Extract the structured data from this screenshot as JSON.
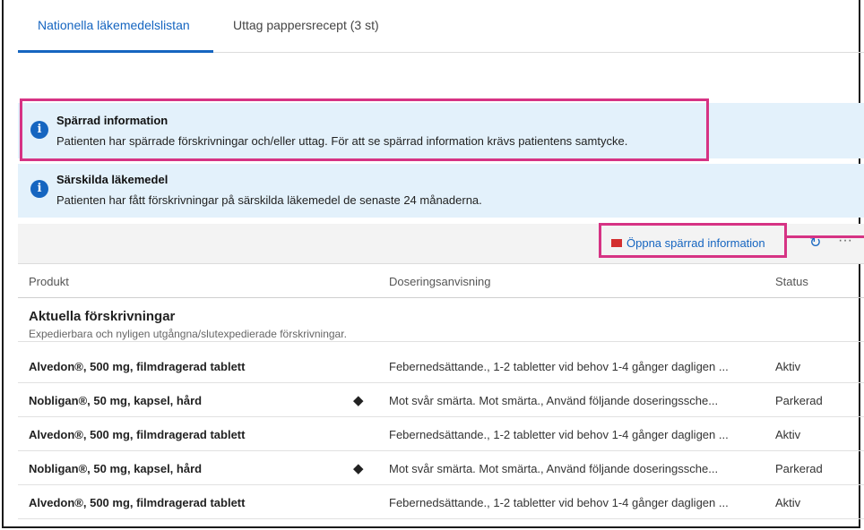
{
  "tabs": [
    {
      "label": "Nationella läkemedelslistan",
      "active": true
    },
    {
      "label": "Uttag pappersrecept (3 st)",
      "active": false
    }
  ],
  "banners": [
    {
      "icon": "info-icon",
      "title": "Spärrad information",
      "text": "Patienten har spärrade förskrivningar och/eller uttag. För att se spärrad information krävs patientens samtycke."
    },
    {
      "icon": "info-icon",
      "title": "Särskilda läkemedel",
      "text": "Patienten har fått förskrivningar på särskilda läkemedel de senaste 24 månaderna."
    }
  ],
  "toolbar": {
    "open_blocked_label": "Öppna spärrad information",
    "refresh_icon": "refresh-icon",
    "more_icon": "more-icon"
  },
  "table": {
    "columns": [
      "Produkt",
      "Doseringsanvisning",
      "Status"
    ],
    "section": {
      "title": "Aktuella förskrivningar",
      "subtitle": "Expedierbara och nyligen utgångna/slutexpedierade förskrivningar."
    },
    "rows": [
      {
        "product": "Alvedon®, 500 mg, filmdragerad tablett",
        "special": false,
        "dosage": "Febernedsättande., 1-2 tabletter vid behov 1-4 gånger dagligen ...",
        "status": "Aktiv"
      },
      {
        "product": "Nobligan®, 50 mg, kapsel, hård",
        "special": true,
        "dosage": "Mot svår smärta. Mot smärta., Använd följande doseringssche...",
        "status": "Parkerad"
      },
      {
        "product": "Alvedon®, 500 mg, filmdragerad tablett",
        "special": false,
        "dosage": "Febernedsättande., 1-2 tabletter vid behov 1-4 gånger dagligen ...",
        "status": "Aktiv"
      },
      {
        "product": "Nobligan®, 50 mg, kapsel, hård",
        "special": true,
        "dosage": "Mot svår smärta. Mot smärta., Använd följande doseringssche...",
        "status": "Parkerad"
      },
      {
        "product": "Alvedon®, 500 mg, filmdragerad tablett",
        "special": false,
        "dosage": "Febernedsättande., 1-2 tabletter vid behov 1-4 gånger dagligen ...",
        "status": "Aktiv"
      }
    ]
  },
  "colors": {
    "accent": "#1565c0",
    "highlight": "#d63384",
    "banner_bg": "#e3f1fb",
    "lock": "#d32f2f"
  }
}
